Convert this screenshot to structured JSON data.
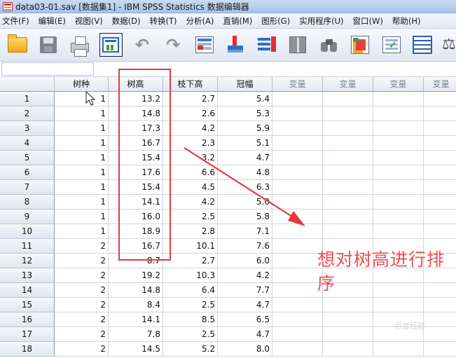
{
  "window": {
    "title": "data03-01.sav [数据集1] - IBM SPSS Statistics 数据编辑器"
  },
  "menu": [
    {
      "label": "文件(F)"
    },
    {
      "label": "编辑(E)"
    },
    {
      "label": "视图(V)"
    },
    {
      "label": "数据(D)"
    },
    {
      "label": "转换(T)"
    },
    {
      "label": "分析(A)"
    },
    {
      "label": "直销(M)"
    },
    {
      "label": "图形(G)"
    },
    {
      "label": "实用程序(U)"
    },
    {
      "label": "窗口(W)"
    },
    {
      "label": "帮助(H)"
    }
  ],
  "toolbar": [
    {
      "icon": "open-folder-icon"
    },
    {
      "icon": "save-icon"
    },
    {
      "icon": "print-icon"
    },
    {
      "icon": "recall-dialog-icon"
    },
    {
      "icon": "undo-icon"
    },
    {
      "icon": "redo-icon"
    },
    {
      "icon": "go-to-case-icon"
    },
    {
      "icon": "insert-case-icon"
    },
    {
      "icon": "insert-variable-icon"
    },
    {
      "icon": "split-file-icon"
    },
    {
      "icon": "find-icon"
    },
    {
      "icon": "value-labels-icon"
    },
    {
      "icon": "weight-cases-icon"
    },
    {
      "icon": "data-grid-icon"
    },
    {
      "icon": "scale-icon"
    }
  ],
  "grid": {
    "columns": [
      "树种",
      "树高",
      "枝下高",
      "冠幅",
      "变量",
      "变量",
      "变量",
      "变量"
    ],
    "rows": [
      [
        "1",
        "1",
        "13.2",
        "2.7",
        "5.4"
      ],
      [
        "2",
        "1",
        "14.8",
        "2.6",
        "5.3"
      ],
      [
        "3",
        "1",
        "17.3",
        "4.2",
        "5.9"
      ],
      [
        "4",
        "1",
        "16.7",
        "2.3",
        "5.1"
      ],
      [
        "5",
        "1",
        "15.4",
        "3.2",
        "4.7"
      ],
      [
        "6",
        "1",
        "17.6",
        "6.6",
        "4.8"
      ],
      [
        "7",
        "1",
        "15.4",
        "4.5",
        "6.3"
      ],
      [
        "8",
        "1",
        "14.1",
        "4.2",
        "5.0"
      ],
      [
        "9",
        "1",
        "16.0",
        "2.5",
        "5.8"
      ],
      [
        "10",
        "1",
        "18.9",
        "2.8",
        "7.1"
      ],
      [
        "11",
        "2",
        "16.7",
        "10.1",
        "7.6"
      ],
      [
        "12",
        "2",
        "8.7",
        "2.7",
        "6.0"
      ],
      [
        "13",
        "2",
        "19.2",
        "10.3",
        "4.2"
      ],
      [
        "14",
        "2",
        "14.8",
        "6.4",
        "7.7"
      ],
      [
        "15",
        "2",
        "8.4",
        "2.5",
        "4.7"
      ],
      [
        "16",
        "2",
        "14.1",
        "8.5",
        "6.5"
      ],
      [
        "17",
        "2",
        "7.8",
        "2.5",
        "4.7"
      ],
      [
        "18",
        "2",
        "14.5",
        "5.2",
        "8.0"
      ]
    ]
  },
  "annotation": {
    "text": "想对树高进行排序",
    "color": "#e53b3b"
  },
  "watermark": "百度经验"
}
